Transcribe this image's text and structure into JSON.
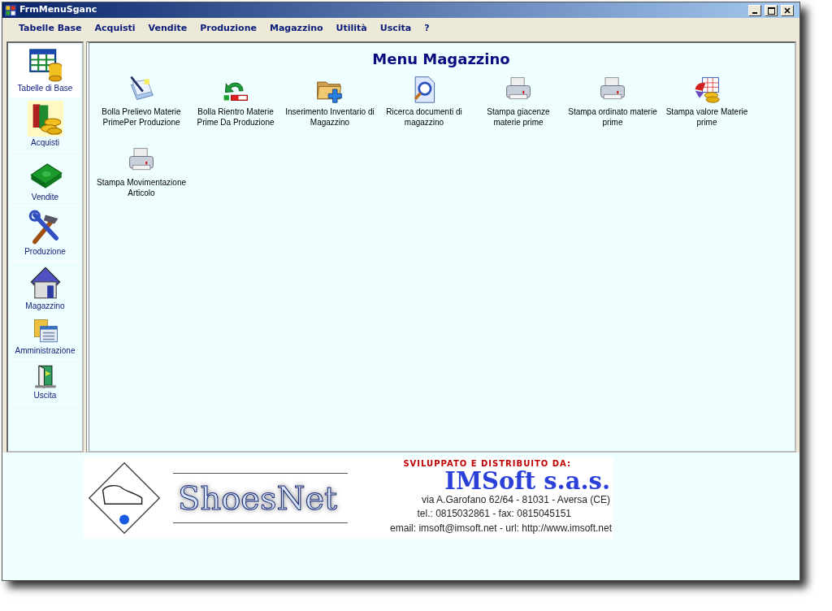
{
  "window": {
    "title": "FrmMenuSganc"
  },
  "menu": [
    "Tabelle Base",
    "Acquisti",
    "Vendite",
    "Produzione",
    "Magazzino",
    "Utilità",
    "Uscita",
    "?"
  ],
  "sidebar": {
    "items": [
      {
        "label": "Tabelle di Base",
        "selected": true
      },
      {
        "label": "Acquisti",
        "selected": false
      },
      {
        "label": "Vendite",
        "selected": false
      },
      {
        "label": "Produzione",
        "selected": false
      },
      {
        "label": "Magazzino",
        "selected": false
      },
      {
        "label": "Amministrazione",
        "selected": false
      },
      {
        "label": "Uscita",
        "selected": false
      }
    ]
  },
  "main": {
    "title": "Menu Magazzino",
    "items": [
      {
        "label": "Bolla Prelievo Materie PrimePer Produzione"
      },
      {
        "label": "Bolla Rientro Materie Prime Da Produzione"
      },
      {
        "label": "Inserimento Inventario di Magazzino"
      },
      {
        "label": "Ricerca documenti di magazzino"
      },
      {
        "label": "Stampa giacenze materie prime"
      },
      {
        "label": "Stampa ordinato materie prime"
      },
      {
        "label": "Stampa valore Materie prime"
      },
      {
        "label": "Stampa Movimentazione Articolo"
      }
    ]
  },
  "banner": {
    "product": "ShoesNet",
    "tagline": "SVILUPPATO E DISTRIBUITO DA:",
    "company": "IMSoft s.a.s.",
    "address": "via A.Garofano 62/64 - 81031 - Aversa (CE)",
    "phone": "tel.: 0815032861 - fax: 0815045151",
    "contact": "email: imsoft@imsoft.net - url: http://www.imsoft.net"
  }
}
